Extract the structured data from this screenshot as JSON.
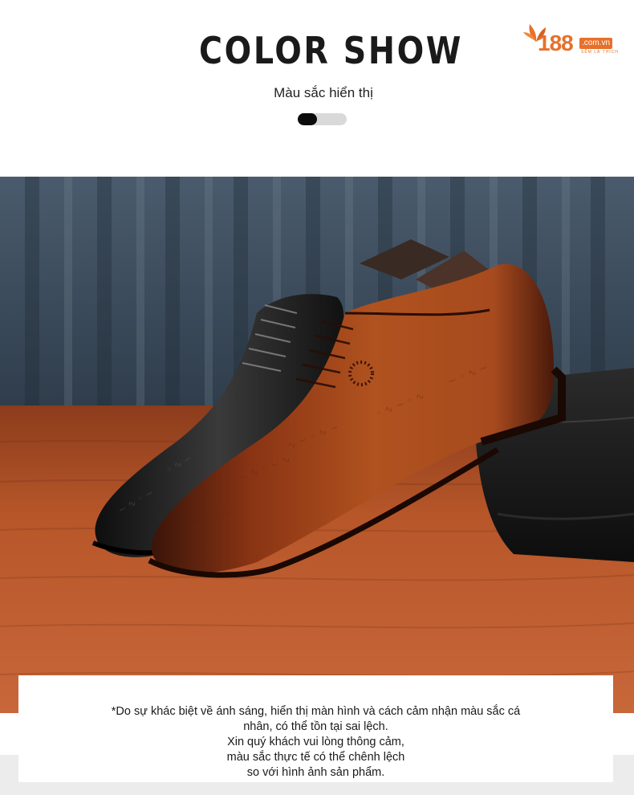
{
  "header": {
    "title": "COLOR SHOW",
    "subtitle": "Màu sắc hiển thị",
    "indicator_progress": 0.4
  },
  "logo": {
    "number": "188",
    "domain": ".com.vn",
    "tagline": "SẼM LÀ THÍCH",
    "brand_color": "#e7702a"
  },
  "photo": {
    "colors": {
      "curtain": "#3d4f60",
      "table": "#b4532b",
      "shoe_brown": "#9a3e1a",
      "shoe_black": "#181818"
    }
  },
  "disclaimer": {
    "lines": [
      "*Do sự khác biệt về ánh sáng, hiển thị màn hình và cách cảm nhận màu sắc cá",
      "nhân, có thể tồn tại sai lệch.",
      "Xin quý khách vui lòng thông cảm,",
      "màu sắc thực tế có thể chênh lệch",
      "so với hình ảnh sản phẩm."
    ]
  }
}
